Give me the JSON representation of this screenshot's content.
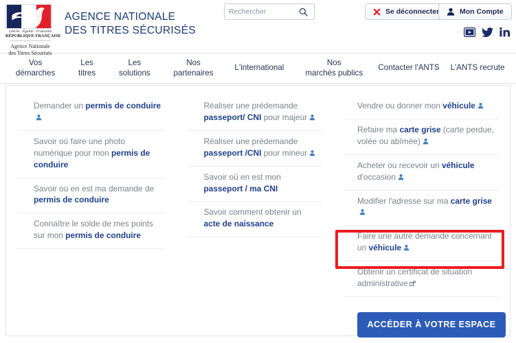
{
  "header": {
    "logo": {
      "devise": "Liberté · Égalité · Fraternité",
      "republique": "RÉPUBLIQUE FRANÇAISE",
      "agency_line1": "Agence Nationale",
      "agency_line2": "des Titres Sécurisés",
      "flag_icon": "french-flag-marianne-icon"
    },
    "title_line1": "AGENCE NATIONALE",
    "title_line2": "DES TITRES SÉCURISÉS",
    "search": {
      "placeholder": "Rechercher",
      "value": "",
      "icon": "search-icon"
    },
    "logout_label": "Se déconnecter",
    "logout_icon": "red-cross-icon",
    "account_label": "Mon Compte",
    "account_icon": "user-icon",
    "socials": [
      {
        "name": "youtube-icon",
        "label": "YouTube"
      },
      {
        "name": "twitter-icon",
        "label": "Twitter"
      },
      {
        "name": "linkedin-icon",
        "label": "LinkedIn"
      }
    ]
  },
  "nav": {
    "items": [
      {
        "line1": "Vos",
        "line2": "démarches"
      },
      {
        "line1": "Les",
        "line2": "titres"
      },
      {
        "line1": "Les",
        "line2": "solutions"
      },
      {
        "line1": "Nos",
        "line2": "partenaires"
      },
      {
        "line1": "L'international",
        "line2": ""
      },
      {
        "line1": "Nos",
        "line2": "marchés publics"
      },
      {
        "line1": "Contacter l'ANTS",
        "line2": ""
      },
      {
        "line1": "L'ANTS recrute",
        "line2": ""
      }
    ]
  },
  "panel": {
    "column1": [
      {
        "html": "Demander un <b>permis de conduire</b>",
        "icon": "user-icon"
      },
      {
        "html": "Savoir où faire une photo numérique pour mon <b>permis de conduire</b>",
        "icon": ""
      },
      {
        "html": "Savoir où en est ma demande de <b>permis de conduire</b>",
        "icon": ""
      },
      {
        "html": "Connaître le solde de mes points sur mon <b>permis de conduire</b>",
        "icon": ""
      }
    ],
    "column2": [
      {
        "html": "Réaliser une prédemande <b>passeport/ CNI</b> pour majeur",
        "icon": "user-icon"
      },
      {
        "html": "Réaliser une prédemande <b>passeport /CNI</b> pour mineur",
        "icon": "user-icon"
      },
      {
        "html": "Savoir où en est mon <b>passeport / ma CNI</b>",
        "icon": ""
      },
      {
        "html": "Savoir comment obtenir un <b>acte de naissance</b>",
        "icon": ""
      }
    ],
    "column3": [
      {
        "html": "Vendre ou donner mon <b>véhicule</b>",
        "icon": "user-icon"
      },
      {
        "html": "Refaire ma <b>carte grise</b> (carte perdue, volée ou abîmée)",
        "icon": "user-icon"
      },
      {
        "html": "Acheter ou recevoir un <b>véhicule</b> d'occasion",
        "icon": "user-icon"
      },
      {
        "html": "Modifier l'adresse sur ma <b>carte grise</b>",
        "icon": "user-icon"
      },
      {
        "html": "Faire une autre demande concernant un <b>véhicule</b>",
        "icon": "user-icon",
        "highlighted": true
      },
      {
        "html": "Obtenir un certificat de situation administrative",
        "icon": "external-link-icon"
      }
    ],
    "cta_label": "ACCÉDER À VOTRE ESPACE"
  },
  "colors": {
    "accent_blue": "#1f3f8f",
    "cta_blue": "#2d5cb8",
    "highlight_red": "#ec1c24",
    "muted_text": "#7b8089",
    "nav_text": "#2a3552"
  }
}
